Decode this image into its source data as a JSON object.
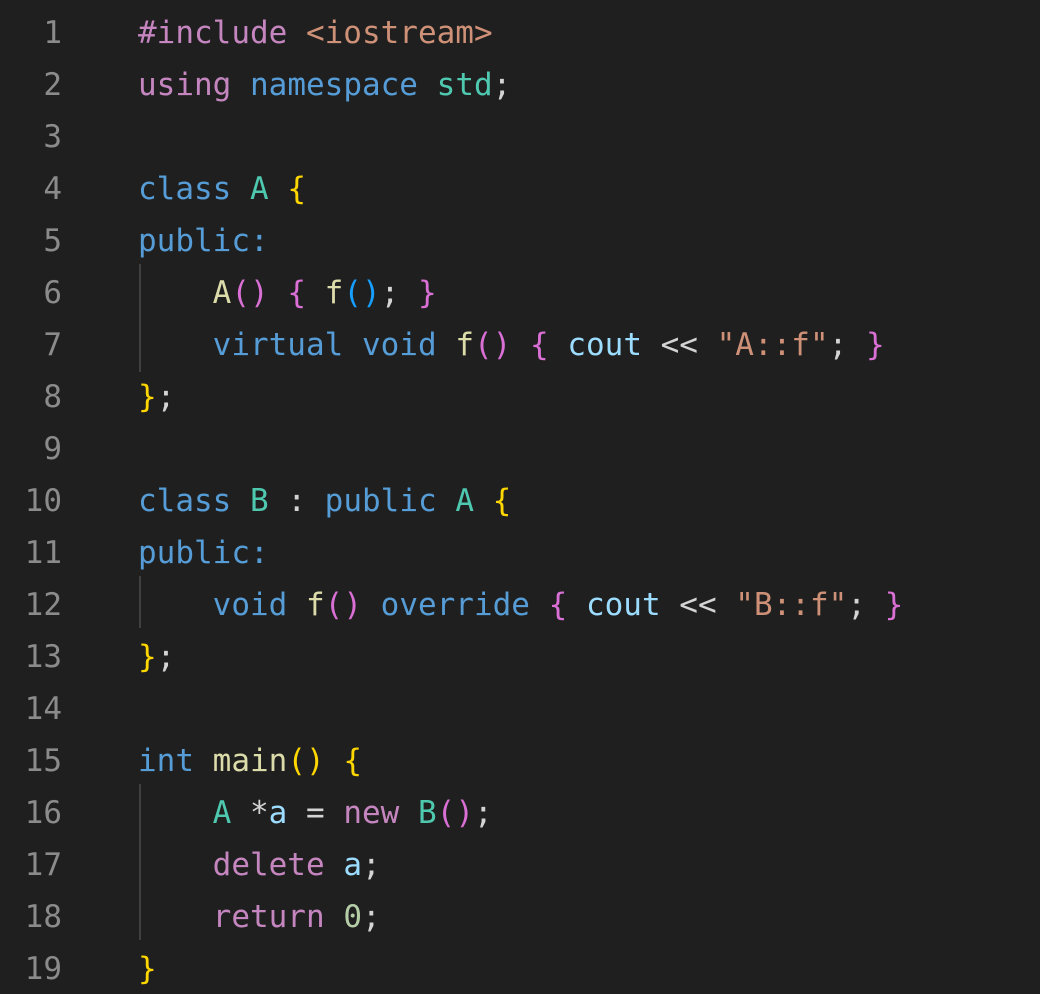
{
  "colors": {
    "background": "#1f1f1f",
    "line_number": "#8b8b8b",
    "indent_guide": "#404040",
    "keyword": "#569cd6",
    "control_keyword": "#c586c0",
    "type_name": "#4ec9b0",
    "function": "#dcdcaa",
    "variable": "#9cdcfe",
    "string": "#ce9178",
    "number": "#b5cea8",
    "bracket_level_1": "#ffd700",
    "bracket_level_2": "#da70d6",
    "bracket_level_3": "#179fff",
    "plain": "#d4d4d4"
  },
  "lines": [
    {
      "number": "1",
      "tokens": [
        {
          "text": "#include ",
          "kind": "control_keyword"
        },
        {
          "text": "<iostream>",
          "kind": "string"
        }
      ]
    },
    {
      "number": "2",
      "tokens": [
        {
          "text": "using",
          "kind": "control_keyword"
        },
        {
          "text": " ",
          "kind": "plain"
        },
        {
          "text": "namespace",
          "kind": "keyword"
        },
        {
          "text": " ",
          "kind": "plain"
        },
        {
          "text": "std",
          "kind": "type_name"
        },
        {
          "text": ";",
          "kind": "plain"
        }
      ]
    },
    {
      "number": "3",
      "tokens": []
    },
    {
      "number": "4",
      "tokens": [
        {
          "text": "class",
          "kind": "keyword"
        },
        {
          "text": " ",
          "kind": "plain"
        },
        {
          "text": "A",
          "kind": "type_name"
        },
        {
          "text": " ",
          "kind": "plain"
        },
        {
          "text": "{",
          "kind": "bracket_level_1"
        }
      ]
    },
    {
      "number": "5",
      "tokens": [
        {
          "text": "public:",
          "kind": "keyword"
        }
      ]
    },
    {
      "number": "6",
      "tokens": [
        {
          "text": "    ",
          "kind": "plain"
        },
        {
          "text": "A",
          "kind": "function"
        },
        {
          "text": "()",
          "kind": "bracket_level_2"
        },
        {
          "text": " ",
          "kind": "plain"
        },
        {
          "text": "{",
          "kind": "bracket_level_2"
        },
        {
          "text": " ",
          "kind": "plain"
        },
        {
          "text": "f",
          "kind": "function"
        },
        {
          "text": "()",
          "kind": "bracket_level_3"
        },
        {
          "text": "; ",
          "kind": "plain"
        },
        {
          "text": "}",
          "kind": "bracket_level_2"
        }
      ]
    },
    {
      "number": "7",
      "tokens": [
        {
          "text": "    ",
          "kind": "plain"
        },
        {
          "text": "virtual",
          "kind": "keyword"
        },
        {
          "text": " ",
          "kind": "plain"
        },
        {
          "text": "void",
          "kind": "keyword"
        },
        {
          "text": " ",
          "kind": "plain"
        },
        {
          "text": "f",
          "kind": "function"
        },
        {
          "text": "()",
          "kind": "bracket_level_2"
        },
        {
          "text": " ",
          "kind": "plain"
        },
        {
          "text": "{",
          "kind": "bracket_level_2"
        },
        {
          "text": " ",
          "kind": "plain"
        },
        {
          "text": "cout",
          "kind": "variable"
        },
        {
          "text": " << ",
          "kind": "plain"
        },
        {
          "text": "\"A::f\"",
          "kind": "string"
        },
        {
          "text": "; ",
          "kind": "plain"
        },
        {
          "text": "}",
          "kind": "bracket_level_2"
        }
      ]
    },
    {
      "number": "8",
      "tokens": [
        {
          "text": "}",
          "kind": "bracket_level_1"
        },
        {
          "text": ";",
          "kind": "plain"
        }
      ]
    },
    {
      "number": "9",
      "tokens": []
    },
    {
      "number": "10",
      "tokens": [
        {
          "text": "class",
          "kind": "keyword"
        },
        {
          "text": " ",
          "kind": "plain"
        },
        {
          "text": "B",
          "kind": "type_name"
        },
        {
          "text": " : ",
          "kind": "plain"
        },
        {
          "text": "public",
          "kind": "keyword"
        },
        {
          "text": " ",
          "kind": "plain"
        },
        {
          "text": "A",
          "kind": "type_name"
        },
        {
          "text": " ",
          "kind": "plain"
        },
        {
          "text": "{",
          "kind": "bracket_level_1"
        }
      ]
    },
    {
      "number": "11",
      "tokens": [
        {
          "text": "public:",
          "kind": "keyword"
        }
      ]
    },
    {
      "number": "12",
      "tokens": [
        {
          "text": "    ",
          "kind": "plain"
        },
        {
          "text": "void",
          "kind": "keyword"
        },
        {
          "text": " ",
          "kind": "plain"
        },
        {
          "text": "f",
          "kind": "function"
        },
        {
          "text": "()",
          "kind": "bracket_level_2"
        },
        {
          "text": " ",
          "kind": "plain"
        },
        {
          "text": "override",
          "kind": "keyword"
        },
        {
          "text": " ",
          "kind": "plain"
        },
        {
          "text": "{",
          "kind": "bracket_level_2"
        },
        {
          "text": " ",
          "kind": "plain"
        },
        {
          "text": "cout",
          "kind": "variable"
        },
        {
          "text": " << ",
          "kind": "plain"
        },
        {
          "text": "\"B::f\"",
          "kind": "string"
        },
        {
          "text": "; ",
          "kind": "plain"
        },
        {
          "text": "}",
          "kind": "bracket_level_2"
        }
      ]
    },
    {
      "number": "13",
      "tokens": [
        {
          "text": "}",
          "kind": "bracket_level_1"
        },
        {
          "text": ";",
          "kind": "plain"
        }
      ]
    },
    {
      "number": "14",
      "tokens": []
    },
    {
      "number": "15",
      "tokens": [
        {
          "text": "int",
          "kind": "keyword"
        },
        {
          "text": " ",
          "kind": "plain"
        },
        {
          "text": "main",
          "kind": "function"
        },
        {
          "text": "()",
          "kind": "bracket_level_1"
        },
        {
          "text": " ",
          "kind": "plain"
        },
        {
          "text": "{",
          "kind": "bracket_level_1"
        }
      ]
    },
    {
      "number": "16",
      "tokens": [
        {
          "text": "    ",
          "kind": "plain"
        },
        {
          "text": "A",
          "kind": "type_name"
        },
        {
          "text": " *",
          "kind": "plain"
        },
        {
          "text": "a",
          "kind": "variable"
        },
        {
          "text": " = ",
          "kind": "plain"
        },
        {
          "text": "new",
          "kind": "control_keyword"
        },
        {
          "text": " ",
          "kind": "plain"
        },
        {
          "text": "B",
          "kind": "type_name"
        },
        {
          "text": "()",
          "kind": "bracket_level_2"
        },
        {
          "text": ";",
          "kind": "plain"
        }
      ]
    },
    {
      "number": "17",
      "tokens": [
        {
          "text": "    ",
          "kind": "plain"
        },
        {
          "text": "delete",
          "kind": "control_keyword"
        },
        {
          "text": " ",
          "kind": "plain"
        },
        {
          "text": "a",
          "kind": "variable"
        },
        {
          "text": ";",
          "kind": "plain"
        }
      ]
    },
    {
      "number": "18",
      "tokens": [
        {
          "text": "    ",
          "kind": "plain"
        },
        {
          "text": "return",
          "kind": "control_keyword"
        },
        {
          "text": " ",
          "kind": "plain"
        },
        {
          "text": "0",
          "kind": "number"
        },
        {
          "text": ";",
          "kind": "plain"
        }
      ]
    },
    {
      "number": "19",
      "tokens": [
        {
          "text": "}",
          "kind": "bracket_level_1"
        }
      ]
    }
  ]
}
